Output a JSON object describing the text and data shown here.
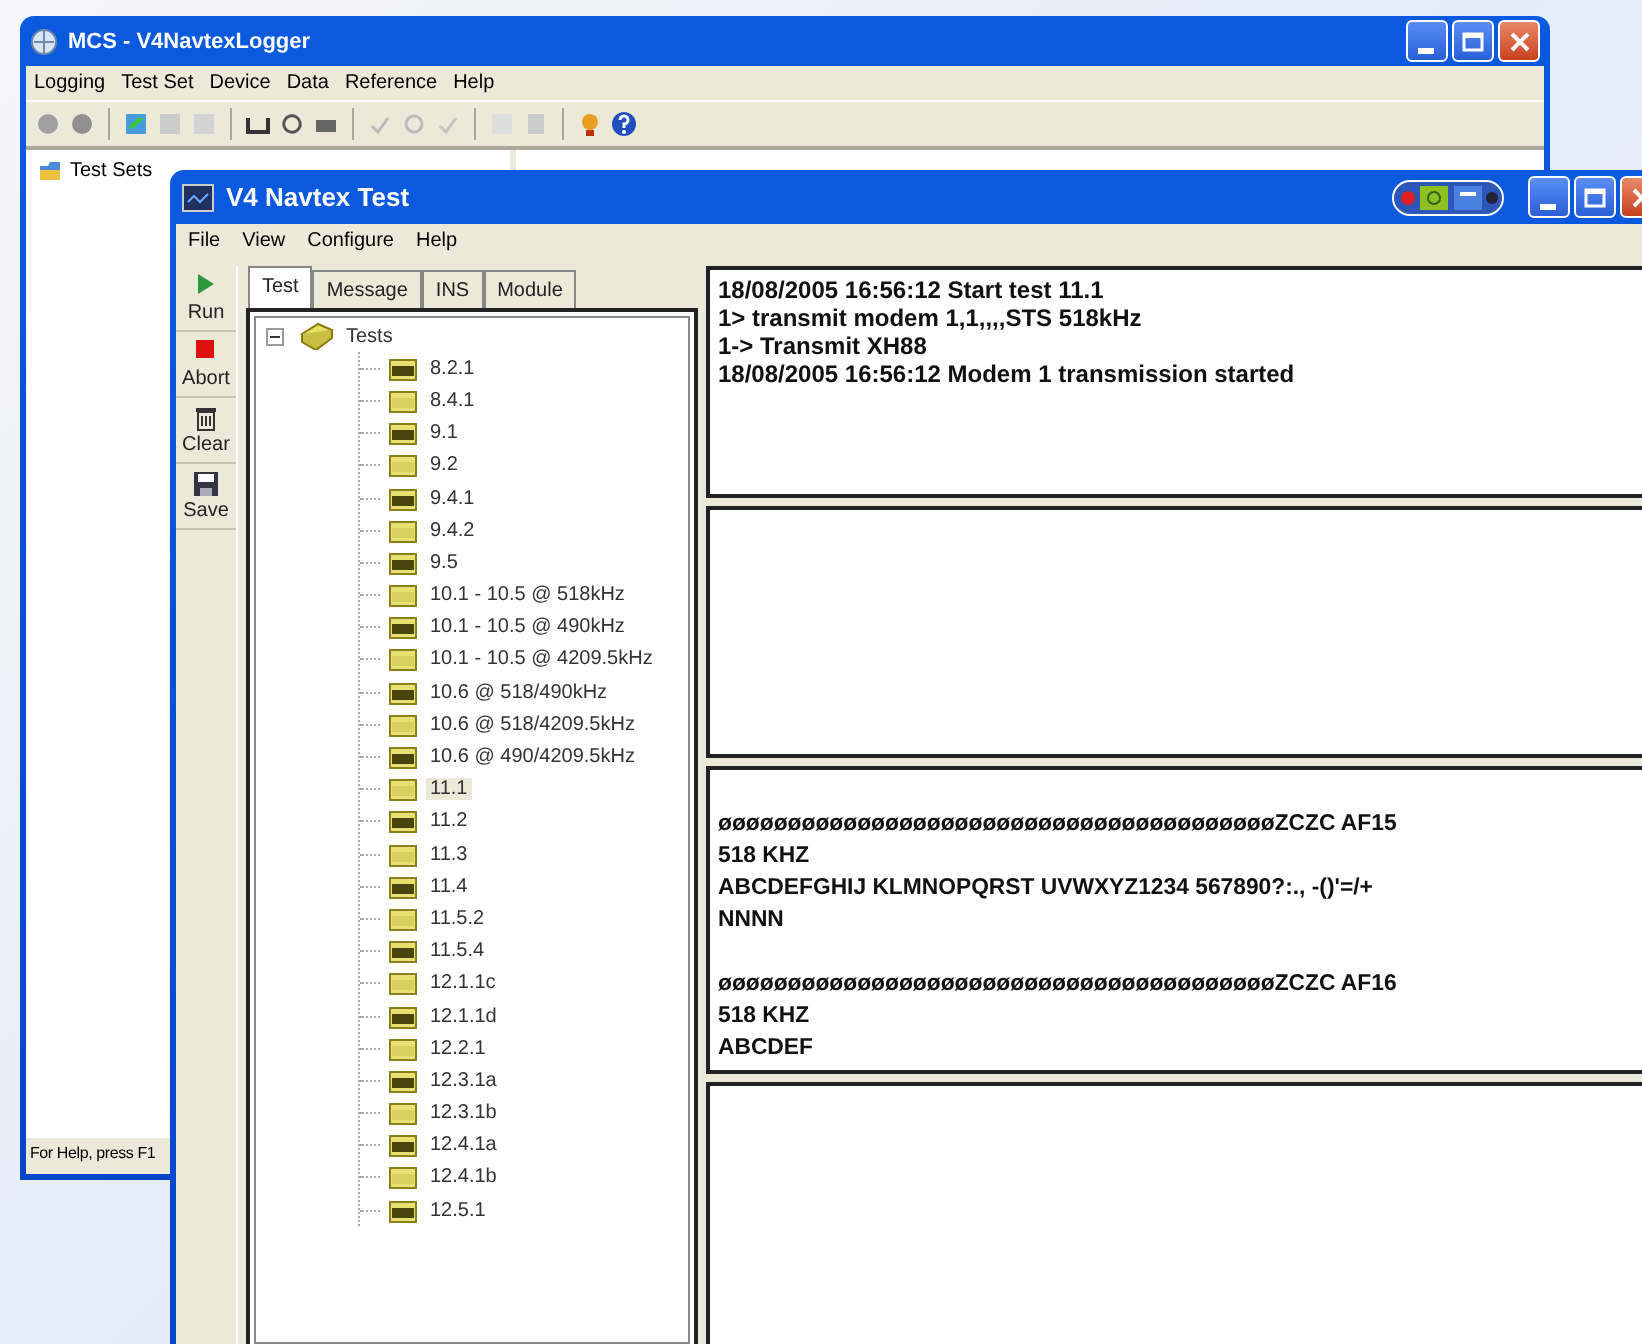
{
  "back_window": {
    "title": "MCS - V4NavtexLogger",
    "menu": [
      "Logging",
      "Test Set",
      "Device",
      "Data",
      "Reference",
      "Help"
    ],
    "tree": [
      {
        "label": "Test Sets"
      }
    ],
    "status_bar": "For Help, press F1"
  },
  "front_window": {
    "title": "V4 Navtex Test",
    "menu": [
      "File",
      "View",
      "Configure",
      "Help"
    ],
    "tools": [
      {
        "label": "Run",
        "kind": "run"
      },
      {
        "label": "Abort",
        "kind": "abort"
      },
      {
        "label": "Clear",
        "kind": "clear"
      },
      {
        "label": "Save",
        "kind": "save"
      }
    ],
    "tabs": [
      {
        "label": "Test",
        "selected": true
      },
      {
        "label": "Message",
        "selected": false
      },
      {
        "label": "INS",
        "selected": false
      },
      {
        "label": "Module",
        "selected": false
      }
    ],
    "tree": {
      "label": "Tests",
      "expanded": true,
      "children": [
        {
          "label": "8.2.1",
          "selected": false
        },
        {
          "label": "8.4.1",
          "selected": false
        },
        {
          "label": "9.1",
          "selected": false
        },
        {
          "label": "9.2",
          "selected": false
        },
        {
          "label": "9.4.1",
          "selected": false
        },
        {
          "label": "9.4.2",
          "selected": false
        },
        {
          "label": "9.5",
          "selected": false
        },
        {
          "label": "10.1 - 10.5 @ 518kHz",
          "selected": false
        },
        {
          "label": "10.1 - 10.5 @ 490kHz",
          "selected": false
        },
        {
          "label": "10.1 - 10.5 @ 4209.5kHz",
          "selected": false
        },
        {
          "label": "10.6 @ 518/490kHz",
          "selected": false
        },
        {
          "label": "10.6 @ 518/4209.5kHz",
          "selected": false
        },
        {
          "label": "10.6 @ 490/4209.5kHz",
          "selected": false
        },
        {
          "label": "11.1",
          "selected": true
        },
        {
          "label": "11.2",
          "selected": false
        },
        {
          "label": "11.3",
          "selected": false
        },
        {
          "label": "11.4",
          "selected": false
        },
        {
          "label": "11.5.2",
          "selected": false
        },
        {
          "label": "11.5.4",
          "selected": false
        },
        {
          "label": "12.1.1c",
          "selected": false
        },
        {
          "label": "12.1.1d",
          "selected": false
        },
        {
          "label": "12.2.1",
          "selected": false
        },
        {
          "label": "12.3.1a",
          "selected": false
        },
        {
          "label": "12.3.1b",
          "selected": false
        },
        {
          "label": "12.4.1a",
          "selected": false
        },
        {
          "label": "12.4.1b",
          "selected": false
        },
        {
          "label": "12.5.1",
          "selected": false
        }
      ]
    },
    "panes": [
      {
        "kind": "log",
        "lines": [
          "18/08/2005 16:56:12 Start test 11.1",
          "1> transmit modem 1,1,,,,STS 518kHz",
          "1-> Transmit XH88",
          "18/08/2005 16:56:12 Modem 1 transmission started"
        ]
      },
      {
        "kind": "blank"
      },
      {
        "kind": "message",
        "blocks": [
          {
            "lines": [
              "øøøøøøøøøøøøøøøøøøøøøøøøøøøøøøøøøøøøøøøøZCZC AF15",
              "518 KHZ",
              "ABCDEFGHIJ KLMNOPQRST UVWXYZ1234 567890?:., -()'=/+",
              "NNNN"
            ]
          },
          {
            "lines": [
              "øøøøøøøøøøøøøøøøøøøøøøøøøøøøøøøøøøøøøøøøZCZC AF16",
              "518 KHZ",
              "ABCDEF"
            ]
          }
        ]
      },
      {
        "kind": "blank"
      }
    ]
  }
}
